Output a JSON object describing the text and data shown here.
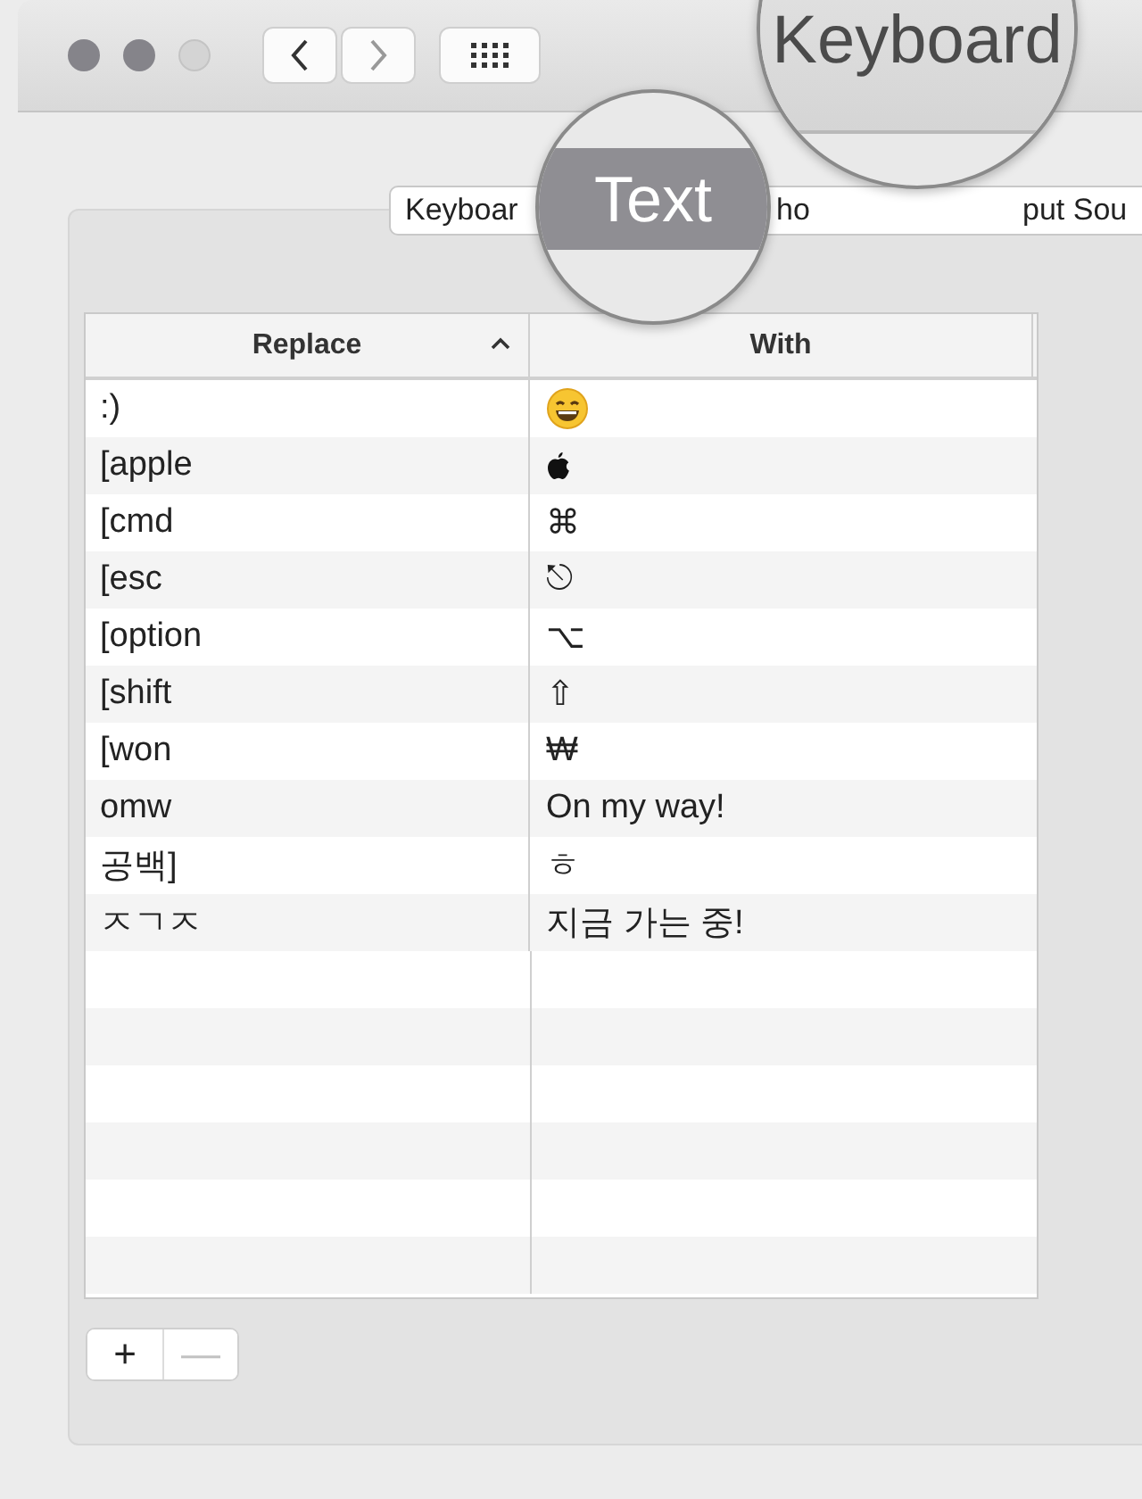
{
  "window": {
    "title": "Keyboard"
  },
  "tabs": [
    {
      "label": "Keyboar",
      "selected": false
    },
    {
      "label": "Text",
      "selected": true
    },
    {
      "label": "ho",
      "selected": false
    },
    {
      "label": "put Sou",
      "selected": false
    }
  ],
  "table": {
    "columns": [
      {
        "label": "Replace",
        "sorted": true
      },
      {
        "label": "With",
        "sorted": false
      }
    ],
    "rows": [
      {
        "replace": ":)",
        "kind": "smiley"
      },
      {
        "replace": "[apple",
        "kind": "apple"
      },
      {
        "replace": "[cmd",
        "kind": "text",
        "with": "⌘"
      },
      {
        "replace": "[esc",
        "kind": "text",
        "with": "⎋"
      },
      {
        "replace": "[option",
        "kind": "text",
        "with": "⌥"
      },
      {
        "replace": "[shift",
        "kind": "text",
        "with": "⇧"
      },
      {
        "replace": "[won",
        "kind": "text",
        "with": "₩"
      },
      {
        "replace": "omw",
        "kind": "text",
        "with": "On my way!"
      },
      {
        "replace": "공백]",
        "kind": "text",
        "with": "ㅎ"
      },
      {
        "replace": "ㅈㄱㅈ",
        "kind": "text",
        "with": "지금 가는 중!"
      }
    ]
  },
  "buttons": [
    {
      "label": "+",
      "disabled": false
    },
    {
      "label": "—",
      "disabled": true
    }
  ]
}
